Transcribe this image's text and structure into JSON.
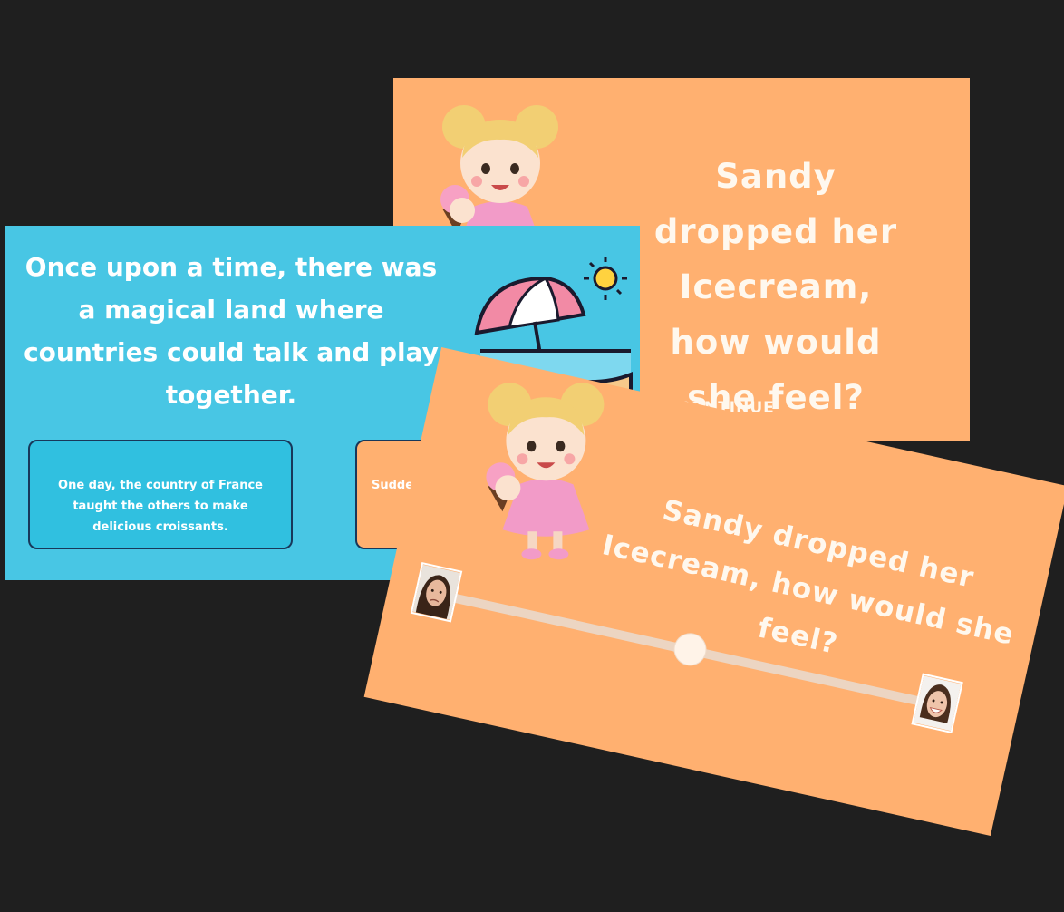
{
  "card_back": {
    "question": "Sandy dropped her Icecream, how would she feel?",
    "continue_label": "K TO CONTINUE"
  },
  "card_story": {
    "story": "Once upon a time, there was a magical land where countries could talk and play together.",
    "choices": [
      "One day, the country of France taught the others to make delicious croissants.",
      "Sudden named"
    ]
  },
  "card_front": {
    "question": "Sandy dropped her Icecream, how would she feel?",
    "slider_value": 0.5
  },
  "colors": {
    "background": "#1f1f1f",
    "orange_card": "#ffb070",
    "blue_card": "#48c6e4",
    "text": "#fff8ee"
  }
}
